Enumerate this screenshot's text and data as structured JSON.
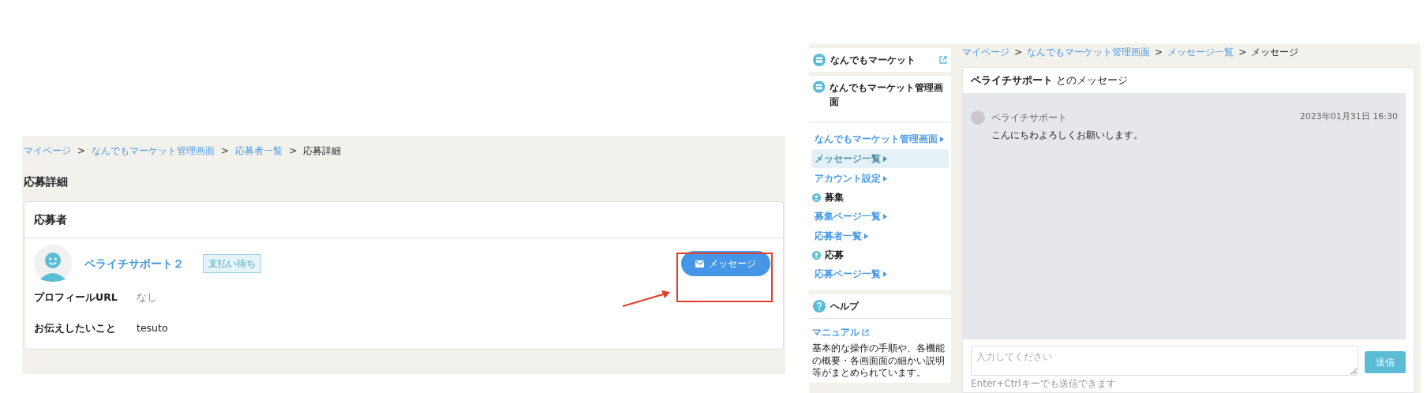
{
  "left": {
    "breadcrumb": [
      {
        "kind": "link",
        "label": "マイページ"
      },
      {
        "kind": "separator",
        "label": ">"
      },
      {
        "kind": "link",
        "label": "なんでもマーケット管理画面"
      },
      {
        "kind": "separator",
        "label": ">"
      },
      {
        "kind": "link",
        "label": "応募者一覧"
      },
      {
        "kind": "separator",
        "label": ">"
      },
      {
        "kind": "current",
        "label": "応募詳細"
      }
    ],
    "page_title": "応募詳細",
    "applicant_card": {
      "title": "応募者",
      "name": "ペライチサポート２",
      "status_badge": "支払い待ち",
      "message_button": "メッセージ",
      "fields": [
        {
          "label": "プロフィールURL",
          "value": "なし",
          "muted": true
        },
        {
          "label": "お伝えしたいこと",
          "value": "tesuto",
          "muted": false
        }
      ]
    }
  },
  "right": {
    "sidebar": {
      "site": {
        "name": "なんでもマーケット"
      },
      "admin": {
        "title": "なんでもマーケット管理画面",
        "items": [
          {
            "label": "なんでもマーケット管理画面",
            "selected": false
          },
          {
            "label": "メッセージ一覧",
            "selected": true
          },
          {
            "label": "アカウント設定",
            "selected": false
          }
        ]
      },
      "sections": [
        {
          "title": "募集",
          "items": [
            {
              "label": "募集ページ一覧",
              "selected": false
            },
            {
              "label": "応募者一覧",
              "selected": false
            }
          ]
        },
        {
          "title": "応募",
          "items": [
            {
              "label": "応募ページ一覧",
              "selected": false
            }
          ]
        }
      ],
      "help": {
        "title": "ヘルプ",
        "manual_link": "マニュアル",
        "description": "基本的な操作の手順や、各機能の概要・各画面面の細かい説明等がまとめられています。"
      }
    },
    "breadcrumb": [
      {
        "kind": "link",
        "label": "マイページ"
      },
      {
        "kind": "separator",
        "label": ">"
      },
      {
        "kind": "link",
        "label": "なんでもマーケット管理画面"
      },
      {
        "kind": "separator",
        "label": ">"
      },
      {
        "kind": "link",
        "label": "メッセージ一覧"
      },
      {
        "kind": "separator",
        "label": ">"
      },
      {
        "kind": "current",
        "label": "メッセージ"
      }
    ],
    "chat": {
      "partner": "ペライチサポート",
      "title_suffix": "とのメッセージ",
      "messages": [
        {
          "sender": "ペライチサポート",
          "time": "2023年01月31日 16:30",
          "text": "こんにちわよろしくお願いします。"
        }
      ],
      "input": {
        "placeholder": "入力してください"
      },
      "send_button": "送信",
      "hint": "Enter+Ctrlキーでも送信できます"
    }
  }
}
